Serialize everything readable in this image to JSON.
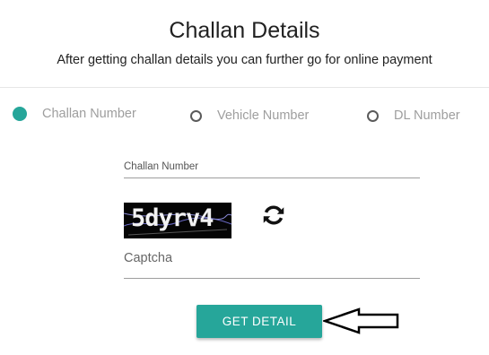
{
  "header": {
    "title": "Challan Details",
    "subtitle": "After getting challan details you can further go for online payment"
  },
  "search_type": {
    "options": [
      {
        "label": "Challan Number",
        "selected": true
      },
      {
        "label": "Vehicle Number",
        "selected": false
      },
      {
        "label": "DL Number",
        "selected": false
      }
    ]
  },
  "form": {
    "challan_number": {
      "label": "Challan Number",
      "value": ""
    },
    "captcha_image_text": "5dyrv4",
    "captcha_field": {
      "placeholder": "Captcha",
      "value": ""
    },
    "submit_label": "GET DETAIL"
  },
  "colors": {
    "accent": "#26a69a"
  },
  "icons": [
    "refresh-icon",
    "arrow-pointer-icon"
  ]
}
